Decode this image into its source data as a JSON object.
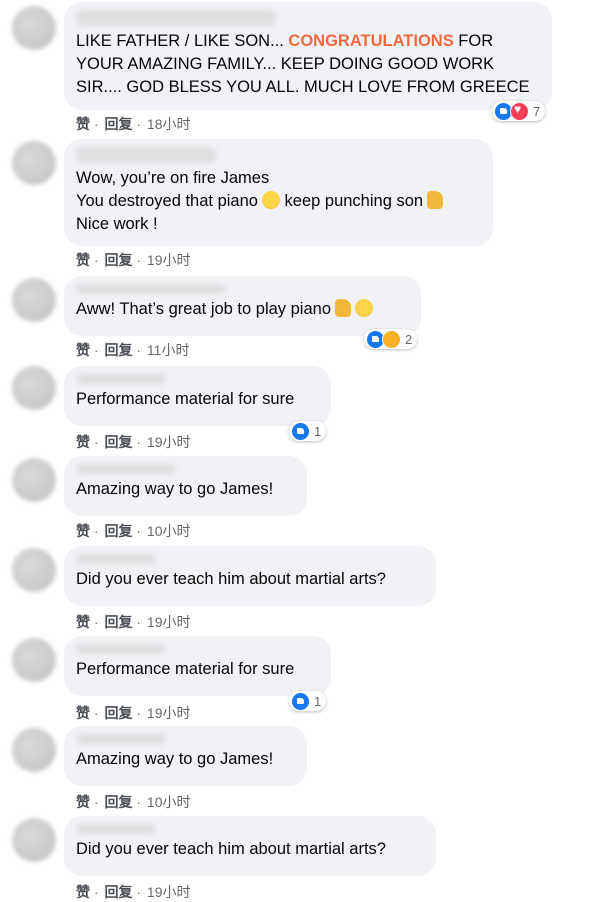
{
  "actions": {
    "like": "赞",
    "dot": "·",
    "reply": "回复"
  },
  "comments": [
    {
      "lines": [
        "LIKE FATHER / LIKE SON... ",
        "CONGRATULATIONS",
        " FOR",
        "YOUR AMAZING FAMILY... KEEP DOING GOOD WORK",
        "SIR.... GOD BLESS YOU ALL. MUCH LOVE FROM GREECE"
      ],
      "time": "18小时",
      "reactions": {
        "icons": [
          "like-icon",
          "love-icon"
        ],
        "count": "7"
      }
    },
    {
      "lines": [
        "Wow, you’re on fire James",
        "You destroyed that piano",
        " keep punching son",
        "Nice work !"
      ],
      "time": "19小时"
    },
    {
      "lines": [
        "Aww! That’s great job to play piano"
      ],
      "time": "11小时",
      "reactions": {
        "icons": [
          "like-icon",
          "care-icon"
        ],
        "count": "2"
      }
    },
    {
      "lines": [
        "Performance material for sure"
      ],
      "time": "19小时",
      "reactions": {
        "icons": [
          "like-icon"
        ],
        "count": "1"
      }
    },
    {
      "lines": [
        "Amazing way to go James!"
      ],
      "time": "10小时"
    },
    {
      "lines": [
        "Did you ever teach him about martial arts?"
      ],
      "time": "19小时"
    },
    {
      "lines": [
        "Performance material for sure"
      ],
      "time": "19小时",
      "reactions": {
        "icons": [
          "like-icon"
        ],
        "count": "1"
      }
    },
    {
      "lines": [
        "Amazing way to go James!"
      ],
      "time": "10小时"
    },
    {
      "lines": [
        "Did you ever teach him about martial arts?"
      ],
      "time": "19小时"
    }
  ]
}
